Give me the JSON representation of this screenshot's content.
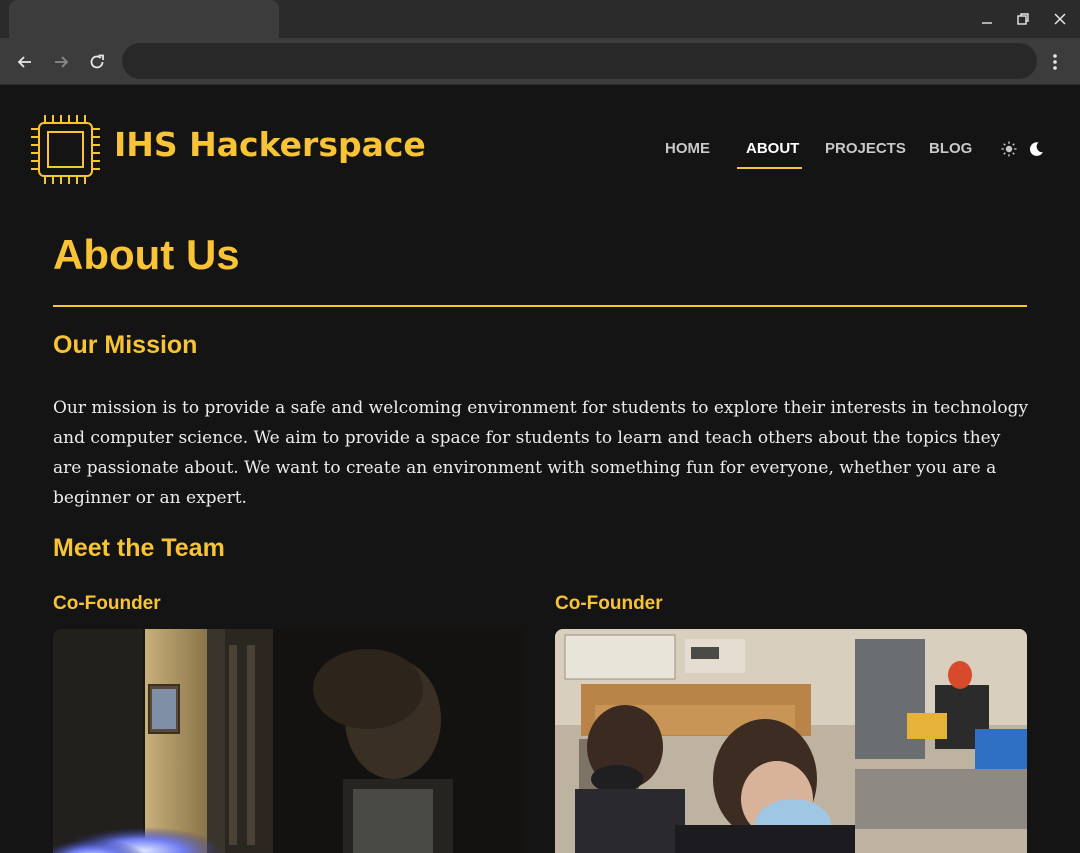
{
  "browser": {
    "tab_title": "",
    "address": "",
    "icons": {
      "minimize": "minimize-icon",
      "restore": "restore-icon",
      "close": "close-icon",
      "back": "back-arrow-icon",
      "forward": "forward-arrow-icon",
      "reload": "reload-icon",
      "menu": "kebab-menu-icon"
    }
  },
  "site": {
    "title": "IHS Hackerspace",
    "logo_icon": "cpu-chip-icon",
    "nav": [
      {
        "label": "HOME",
        "active": false
      },
      {
        "label": "ABOUT",
        "active": true
      },
      {
        "label": "PROJECTS",
        "active": false
      },
      {
        "label": "BLOG",
        "active": false
      }
    ],
    "theme_toggle": {
      "light_icon": "sun-icon",
      "dark_icon": "moon-icon"
    }
  },
  "page": {
    "heading": "About Us",
    "mission_heading": "Our Mission",
    "mission_text": "Our mission is to provide a safe and welcoming environment for students to explore their interests in technology and computer science. We aim to provide a space for students to learn and teach others about the topics they are passionate about. We want to create an environment with something fun for everyone, whether you are a beginner or an expert.",
    "team_heading": "Meet the Team",
    "team": [
      {
        "role": "Co-Founder",
        "photo": "photo of a student with a blue flame in a dark room"
      },
      {
        "role": "Co-Founder",
        "photo": "photo of students wearing masks in a workshop with 3D printers"
      }
    ]
  },
  "colors": {
    "accent": "#f8c334",
    "background": "#141414",
    "text": "#ececec",
    "nav_text": "#c8c8c8"
  }
}
